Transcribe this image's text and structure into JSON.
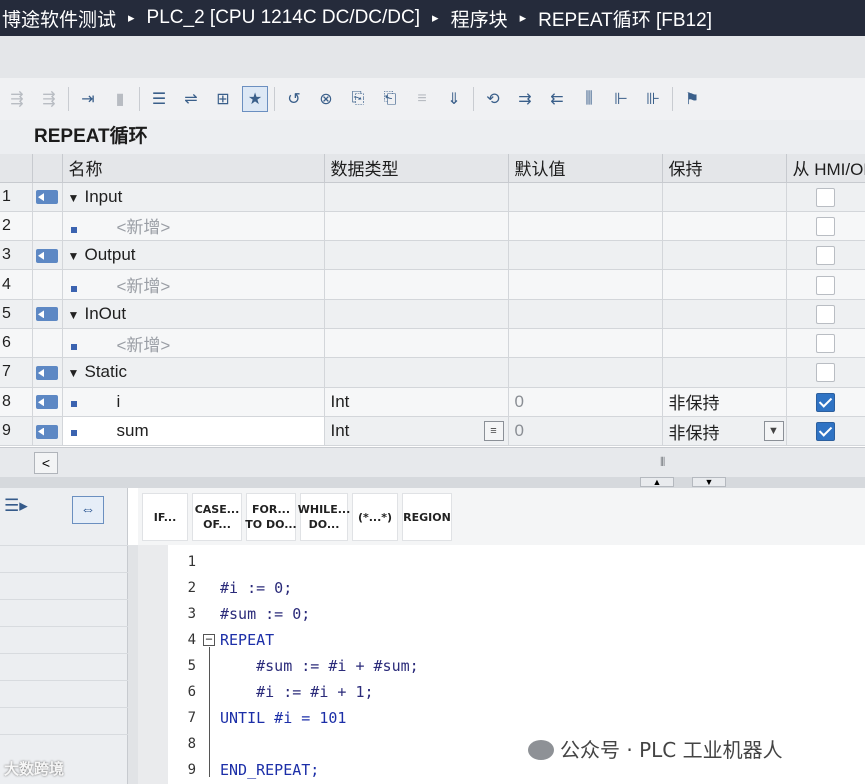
{
  "breadcrumb": {
    "items": [
      "博途软件测试",
      "PLC_2 [CPU 1214C DC/DC/DC]",
      "程序块",
      "REPEAT循环 [FB12]"
    ],
    "separator": "▸"
  },
  "block_title": "REPEAT循环",
  "interface_table": {
    "columns": [
      "名称",
      "数据类型",
      "默认值",
      "保持",
      "从 HMI/OPC"
    ],
    "rows": [
      {
        "num": "1",
        "name": "Input",
        "section": true,
        "type": "",
        "default": "",
        "retain": "",
        "hmi": false
      },
      {
        "num": "2",
        "name": "<新增>",
        "placeholder": true,
        "type": "",
        "default": "",
        "retain": "",
        "hmi": false
      },
      {
        "num": "3",
        "name": "Output",
        "section": true,
        "type": "",
        "default": "",
        "retain": "",
        "hmi": false
      },
      {
        "num": "4",
        "name": "<新增>",
        "placeholder": true,
        "type": "",
        "default": "",
        "retain": "",
        "hmi": false
      },
      {
        "num": "5",
        "name": "InOut",
        "section": true,
        "type": "",
        "default": "",
        "retain": "",
        "hmi": false
      },
      {
        "num": "6",
        "name": "<新增>",
        "placeholder": true,
        "type": "",
        "default": "",
        "retain": "",
        "hmi": false
      },
      {
        "num": "7",
        "name": "Static",
        "section": true,
        "type": "",
        "default": "",
        "retain": "",
        "hmi": false
      },
      {
        "num": "8",
        "name": "i",
        "type": "Int",
        "default": "0",
        "retain": "非保持",
        "hmi": true
      },
      {
        "num": "9",
        "name": "sum",
        "type": "Int",
        "default": "0",
        "retain": "非保持",
        "hmi": true
      }
    ]
  },
  "scl_toolbar": {
    "buttons": [
      "IF...",
      "CASE...\nOF...",
      "FOR...\nTO DO...",
      "WHILE...\nDO...",
      "(*...*)",
      "REGION"
    ]
  },
  "code_editor": {
    "lines": [
      {
        "n": "1",
        "text": ""
      },
      {
        "n": "2",
        "text": "#i := 0;"
      },
      {
        "n": "3",
        "text": "#sum := 0;"
      },
      {
        "n": "4",
        "text": "REPEAT"
      },
      {
        "n": "5",
        "text": "    #sum := #i + #sum;"
      },
      {
        "n": "6",
        "text": "    #i := #i + 1;"
      },
      {
        "n": "7",
        "text": "UNTIL #i = 101"
      },
      {
        "n": "8",
        "text": ""
      },
      {
        "n": "9",
        "text": "END_REPEAT;"
      }
    ]
  },
  "watermark": "公众号 · PLC 工业机器人",
  "logo_text": "大数跨境",
  "colors": {
    "titlebar_bg": "#252b3b",
    "header_bg": "#e4e6e9",
    "accent_blue": "#2f73c4",
    "icon_blue": "#5d88c4"
  }
}
